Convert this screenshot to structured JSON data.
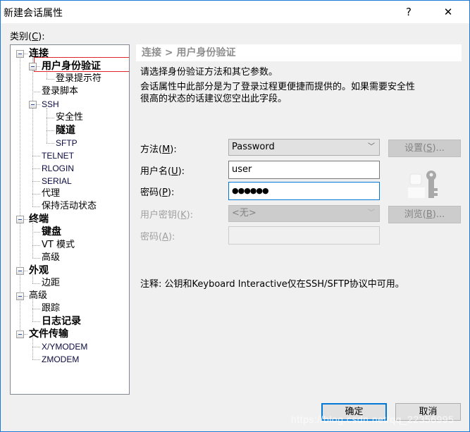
{
  "window": {
    "title": "新建会话属性",
    "help_glyph": "?",
    "close_glyph": "✕"
  },
  "category": {
    "label": "类别(",
    "mnemonic": "C",
    "label_end": "):"
  },
  "tree": {
    "items": [
      {
        "label": "连接",
        "bold": true,
        "expanded": true,
        "level": 0
      },
      {
        "label": "用户身份验证",
        "bold": true,
        "expanded": true,
        "level": 1,
        "selected": true
      },
      {
        "label": "登录提示符",
        "bold": false,
        "level": 2
      },
      {
        "label": "登录脚本",
        "bold": false,
        "level": 1
      },
      {
        "label": "SSH",
        "bold": false,
        "expanded": true,
        "level": 1
      },
      {
        "label": "安全性",
        "bold": false,
        "level": 2
      },
      {
        "label": "隧道",
        "bold": true,
        "level": 2
      },
      {
        "label": "SFTP",
        "bold": false,
        "level": 2
      },
      {
        "label": "TELNET",
        "bold": false,
        "level": 1
      },
      {
        "label": "RLOGIN",
        "bold": false,
        "level": 1
      },
      {
        "label": "SERIAL",
        "bold": false,
        "level": 1
      },
      {
        "label": "代理",
        "bold": false,
        "level": 1
      },
      {
        "label": "保持活动状态",
        "bold": false,
        "level": 1
      },
      {
        "label": "终端",
        "bold": true,
        "expanded": true,
        "level": 0
      },
      {
        "label": "键盘",
        "bold": true,
        "level": 1
      },
      {
        "label": "VT 模式",
        "bold": false,
        "level": 1
      },
      {
        "label": "高级",
        "bold": false,
        "level": 1
      },
      {
        "label": "外观",
        "bold": true,
        "expanded": true,
        "level": 0
      },
      {
        "label": "边距",
        "bold": false,
        "level": 1
      },
      {
        "label": "高级",
        "bold": false,
        "expanded": true,
        "level": 0
      },
      {
        "label": "跟踪",
        "bold": false,
        "level": 1
      },
      {
        "label": "日志记录",
        "bold": true,
        "level": 1
      },
      {
        "label": "文件传输",
        "bold": true,
        "expanded": true,
        "level": 0
      },
      {
        "label": "X/YMODEM",
        "bold": false,
        "level": 1
      },
      {
        "label": "ZMODEM",
        "bold": false,
        "level": 1
      }
    ]
  },
  "panel": {
    "breadcrumb": "连接 > 用户身份验证",
    "desc1": "请选择身份验证方法和其它参数。",
    "desc2_line1": "会话属性中此部分是为了登录过程更便捷而提供的。如果需要安全性",
    "desc2_line2": "很高的状态的话建议您空出此字段。",
    "method": {
      "label": "方法(",
      "mnemonic": "M",
      "label_end": "):",
      "value": "Password"
    },
    "username": {
      "label": "用户名(",
      "mnemonic": "U",
      "label_end": "):",
      "value": "user"
    },
    "password": {
      "label": "密码(",
      "mnemonic": "P",
      "label_end": "):",
      "value": "●●●●●●"
    },
    "user_key": {
      "label": "用户密钥(",
      "mnemonic": "K",
      "label_end": "):",
      "value": "<无>"
    },
    "passphrase": {
      "label": "密码(",
      "mnemonic": "A",
      "label_end": "):",
      "value": ""
    },
    "settings_button": {
      "label": "设置(",
      "mnemonic": "S",
      "label_end": ")..."
    },
    "browse_button": {
      "label": "浏览(",
      "mnemonic": "B",
      "label_end": ")..."
    },
    "note": "注释: 公钥和Keyboard Interactive仅在SSH/SFTP协议中可用。"
  },
  "footer": {
    "ok_label": "确定",
    "cancel_label": "取消"
  },
  "watermark": "https://blog.csdn.net/qq_22356995",
  "colors": {
    "accent": "#0078d7",
    "selection_outline": "#e0262b",
    "window_border": "#1c7ad6"
  }
}
